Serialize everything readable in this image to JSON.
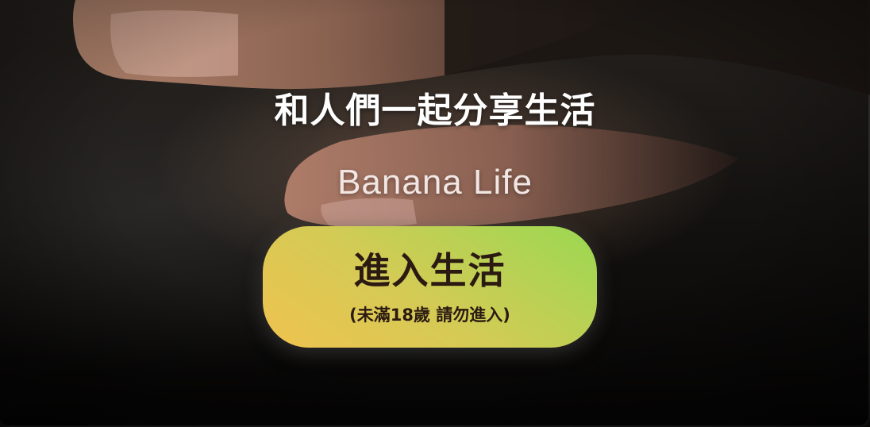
{
  "background": {
    "image": "hand-photo"
  },
  "hero": {
    "headline": "和人們一起分享生活",
    "brand_name": "Banana Life"
  },
  "enter_button": {
    "label": "進入生活",
    "age_note": "(未滿18歲 請勿進入)"
  },
  "colors": {
    "button_gradient_start": "#f0c24f",
    "button_gradient_end": "#9ad852",
    "button_text": "#2b1a12",
    "headline_text": "#ffffff",
    "brand_text": "#f1e6e3"
  }
}
